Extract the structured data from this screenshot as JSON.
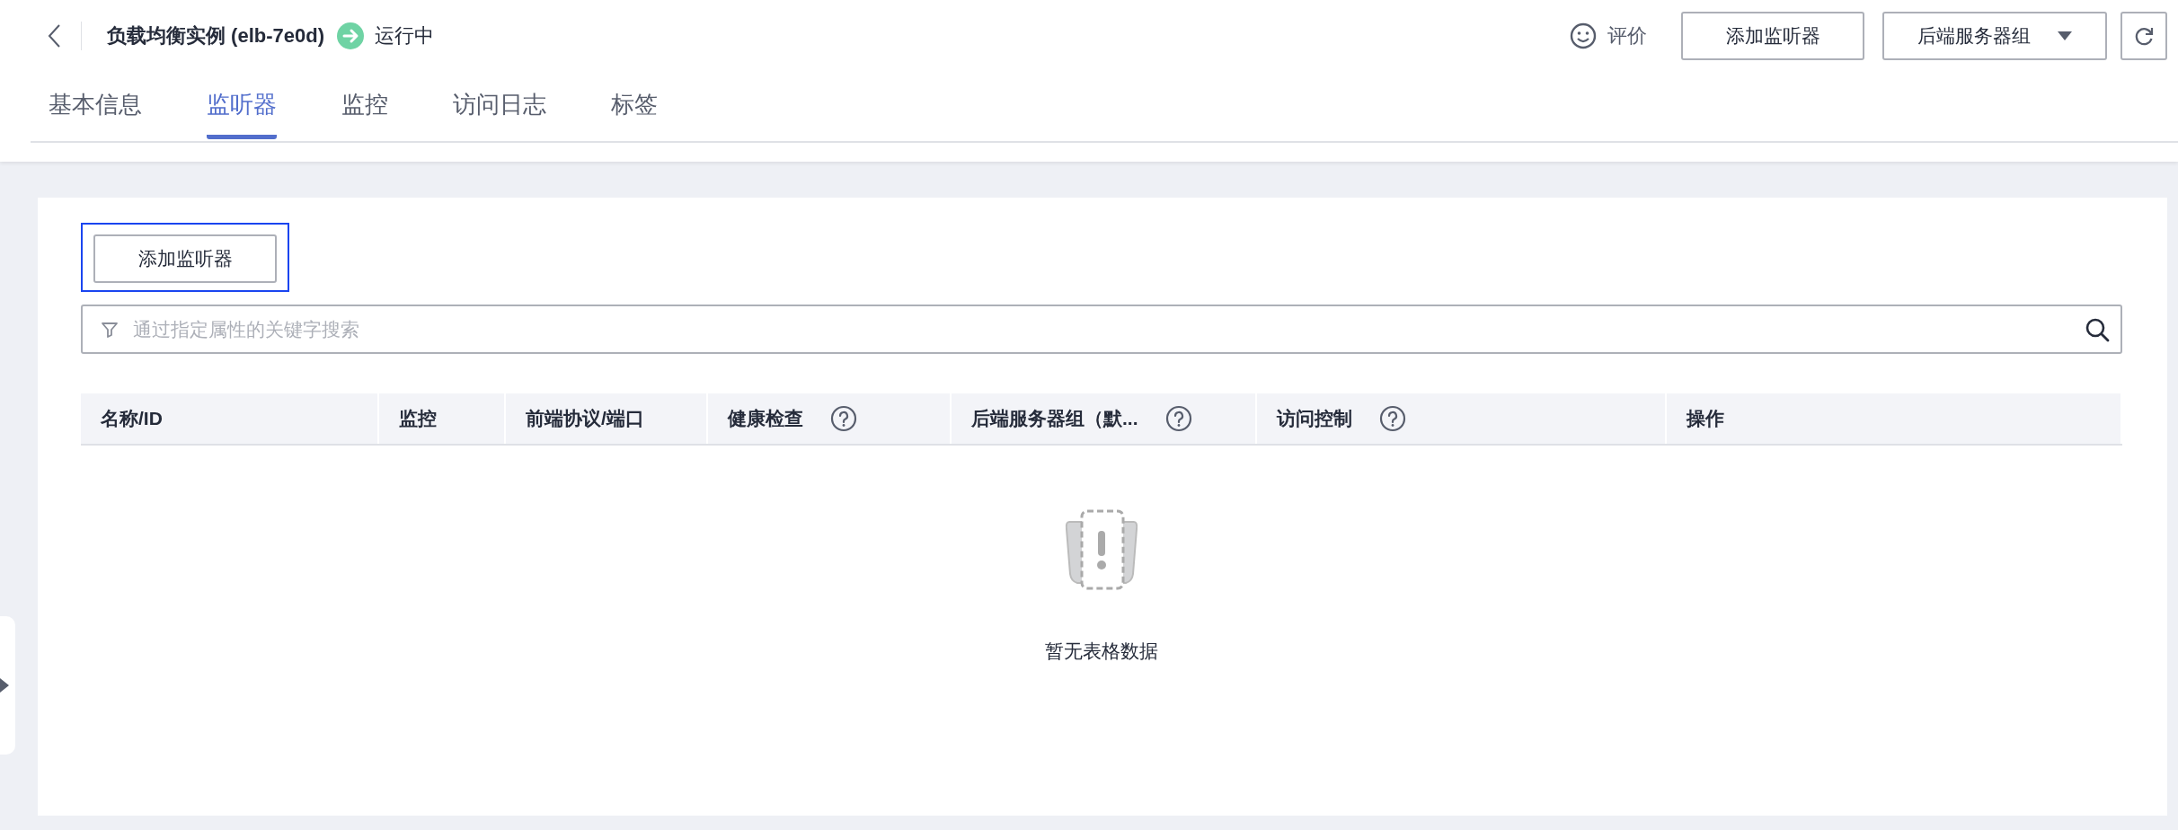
{
  "header": {
    "title": "负载均衡实例 (elb-7e0d)",
    "status": "运行中",
    "feedback": "评价",
    "actions": [
      {
        "kind": "button",
        "label": "添加监听器"
      },
      {
        "kind": "dropdown",
        "label": "后端服务器组"
      },
      {
        "kind": "refresh"
      }
    ]
  },
  "tabs": [
    {
      "label": "基本信息",
      "selected": false
    },
    {
      "label": "监听器",
      "selected": true
    },
    {
      "label": "监控",
      "selected": false
    },
    {
      "label": "访问日志",
      "selected": false
    },
    {
      "label": "标签",
      "selected": false
    }
  ],
  "panel": {
    "add_button": {
      "label": "添加监听器",
      "focused": true
    },
    "search": {
      "placeholder": "通过指定属性的关键字搜索"
    },
    "table": {
      "columns": [
        {
          "label": "名称/ID",
          "help": false
        },
        {
          "label": "监控",
          "help": false
        },
        {
          "label": "前端协议/端口",
          "help": false
        },
        {
          "label": "健康检查",
          "help": true
        },
        {
          "label": "后端服务器组（默...",
          "help": true
        },
        {
          "label": "访问控制",
          "help": true
        },
        {
          "label": "操作",
          "help": false
        }
      ],
      "empty_text": "暂无表格数据"
    }
  }
}
